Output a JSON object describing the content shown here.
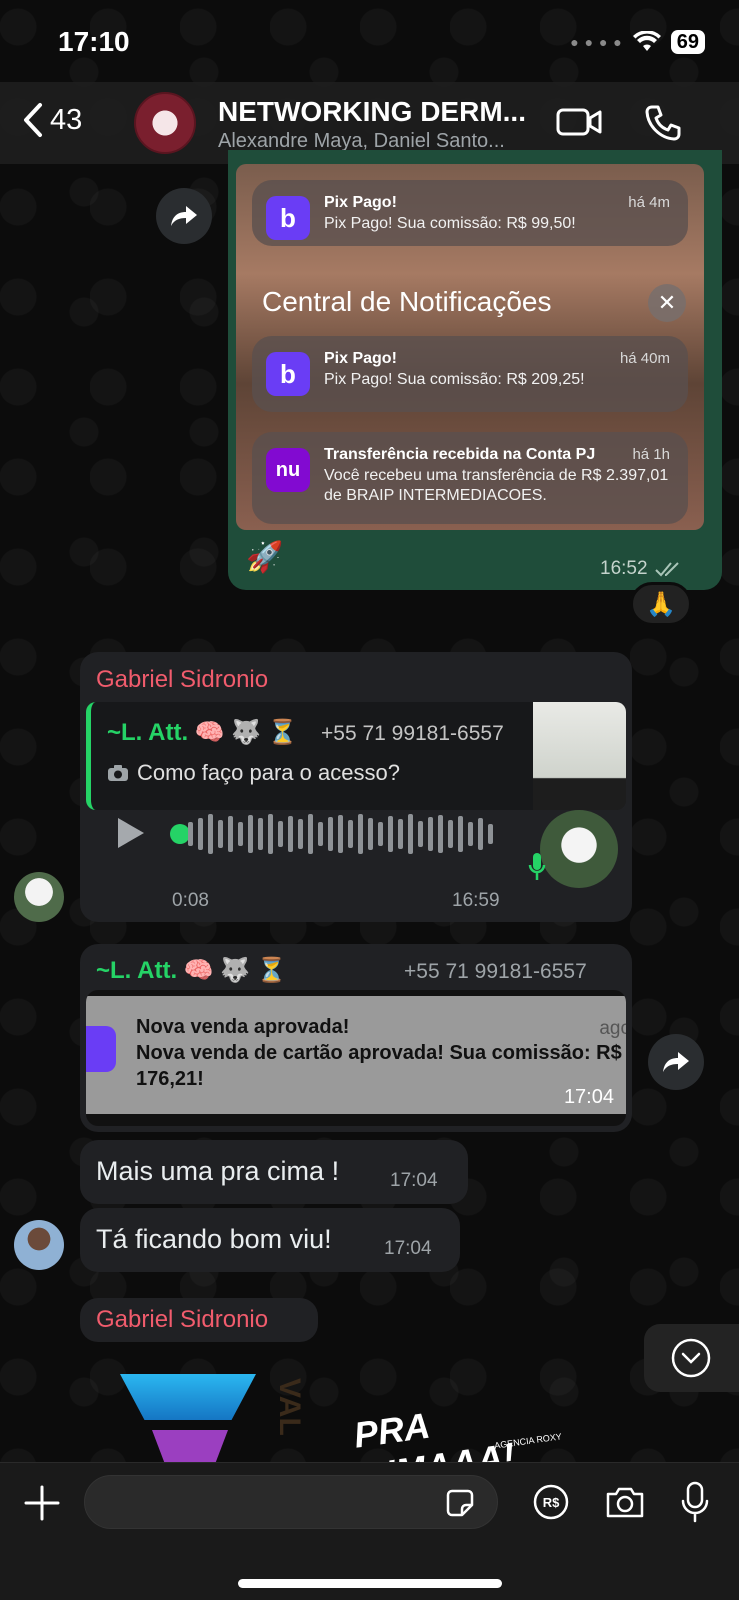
{
  "status": {
    "time": "17:10",
    "battery": "69"
  },
  "header": {
    "back_count": "43",
    "title": "NETWORKING DERM...",
    "subtitle": "Alexandre Maya, Daniel Santo..."
  },
  "msg1": {
    "notifications": [
      {
        "app": "b",
        "title": "Pix Pago!",
        "body": "Pix Pago! Sua comissão: R$ 99,50!",
        "ago": "há 4m"
      },
      {
        "app": "b",
        "title": "Pix Pago!",
        "body": "Pix Pago! Sua comissão: R$ 209,25!",
        "ago": "há 40m"
      },
      {
        "app": "nu",
        "title": "Transferência recebida na Conta PJ",
        "body": "Você recebeu uma transferência de R$ 2.397,01 de BRAIP INTERMEDIACOES.",
        "ago": "há 1h"
      }
    ],
    "central_title": "Central de Notificações",
    "caption_emoji": "🚀",
    "time": "16:52",
    "reaction": "🙏"
  },
  "msg2": {
    "sender": "Gabriel Sidronio",
    "quote_author": "~L. Att. 🧠 🐺 ⏳",
    "quote_phone": "+55 71 99181-6557",
    "quote_text": "Como faço para o acesso?",
    "duration": "0:08",
    "time": "16:59"
  },
  "msg3": {
    "quote_author": "~L. Att. 🧠 🐺 ⏳",
    "phone": "+55 71 99181-6557",
    "notif_title": "Nova venda aprovada!",
    "notif_body": "Nova venda de cartão aprovada! Sua comissão: R$ 176,21!",
    "notif_ago": "agc",
    "time": "17:04"
  },
  "msg4": {
    "text": "Mais uma pra cima !",
    "time": "17:04"
  },
  "msg5": {
    "text": "Tá ficando bom viu!",
    "time": "17:04"
  },
  "msg6": {
    "sender": "Gabriel Sidronio",
    "sticker_text": "PRA CIMAAA!",
    "sticker_sub": "AGENCIA ROXY",
    "sticker_side": "VAL"
  },
  "input": {
    "placeholder": ""
  },
  "colors": {
    "outgoing": "#1f4d3a",
    "incoming": "#202124",
    "sender": "#f15c6d",
    "quote_author": "#25d366",
    "accent": "#25d366"
  }
}
